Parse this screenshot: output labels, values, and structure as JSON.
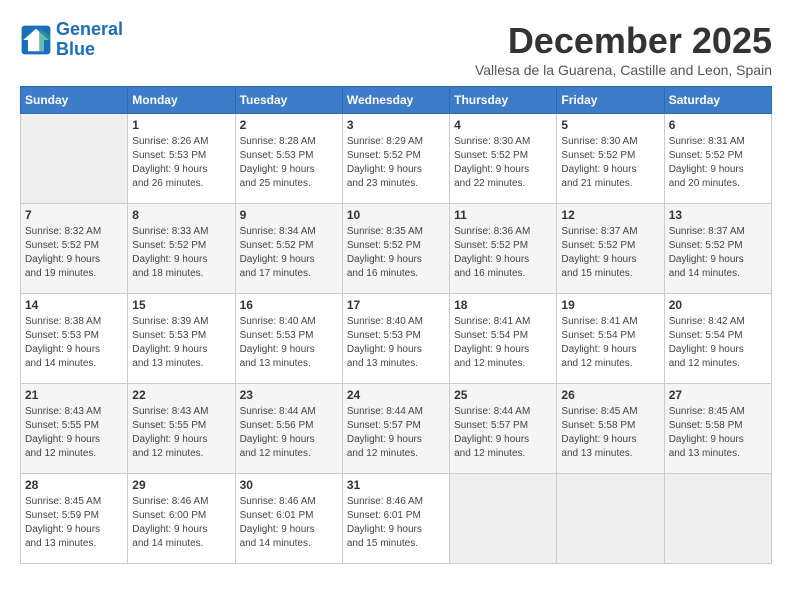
{
  "header": {
    "logo_line1": "General",
    "logo_line2": "Blue",
    "month_title": "December 2025",
    "location": "Vallesa de la Guarena, Castille and Leon, Spain"
  },
  "days_of_week": [
    "Sunday",
    "Monday",
    "Tuesday",
    "Wednesday",
    "Thursday",
    "Friday",
    "Saturday"
  ],
  "weeks": [
    [
      {
        "day": "",
        "info": ""
      },
      {
        "day": "1",
        "info": "Sunrise: 8:26 AM\nSunset: 5:53 PM\nDaylight: 9 hours\nand 26 minutes."
      },
      {
        "day": "2",
        "info": "Sunrise: 8:28 AM\nSunset: 5:53 PM\nDaylight: 9 hours\nand 25 minutes."
      },
      {
        "day": "3",
        "info": "Sunrise: 8:29 AM\nSunset: 5:52 PM\nDaylight: 9 hours\nand 23 minutes."
      },
      {
        "day": "4",
        "info": "Sunrise: 8:30 AM\nSunset: 5:52 PM\nDaylight: 9 hours\nand 22 minutes."
      },
      {
        "day": "5",
        "info": "Sunrise: 8:30 AM\nSunset: 5:52 PM\nDaylight: 9 hours\nand 21 minutes."
      },
      {
        "day": "6",
        "info": "Sunrise: 8:31 AM\nSunset: 5:52 PM\nDaylight: 9 hours\nand 20 minutes."
      }
    ],
    [
      {
        "day": "7",
        "info": "Sunrise: 8:32 AM\nSunset: 5:52 PM\nDaylight: 9 hours\nand 19 minutes."
      },
      {
        "day": "8",
        "info": "Sunrise: 8:33 AM\nSunset: 5:52 PM\nDaylight: 9 hours\nand 18 minutes."
      },
      {
        "day": "9",
        "info": "Sunrise: 8:34 AM\nSunset: 5:52 PM\nDaylight: 9 hours\nand 17 minutes."
      },
      {
        "day": "10",
        "info": "Sunrise: 8:35 AM\nSunset: 5:52 PM\nDaylight: 9 hours\nand 16 minutes."
      },
      {
        "day": "11",
        "info": "Sunrise: 8:36 AM\nSunset: 5:52 PM\nDaylight: 9 hours\nand 16 minutes."
      },
      {
        "day": "12",
        "info": "Sunrise: 8:37 AM\nSunset: 5:52 PM\nDaylight: 9 hours\nand 15 minutes."
      },
      {
        "day": "13",
        "info": "Sunrise: 8:37 AM\nSunset: 5:52 PM\nDaylight: 9 hours\nand 14 minutes."
      }
    ],
    [
      {
        "day": "14",
        "info": "Sunrise: 8:38 AM\nSunset: 5:53 PM\nDaylight: 9 hours\nand 14 minutes."
      },
      {
        "day": "15",
        "info": "Sunrise: 8:39 AM\nSunset: 5:53 PM\nDaylight: 9 hours\nand 13 minutes."
      },
      {
        "day": "16",
        "info": "Sunrise: 8:40 AM\nSunset: 5:53 PM\nDaylight: 9 hours\nand 13 minutes."
      },
      {
        "day": "17",
        "info": "Sunrise: 8:40 AM\nSunset: 5:53 PM\nDaylight: 9 hours\nand 13 minutes."
      },
      {
        "day": "18",
        "info": "Sunrise: 8:41 AM\nSunset: 5:54 PM\nDaylight: 9 hours\nand 12 minutes."
      },
      {
        "day": "19",
        "info": "Sunrise: 8:41 AM\nSunset: 5:54 PM\nDaylight: 9 hours\nand 12 minutes."
      },
      {
        "day": "20",
        "info": "Sunrise: 8:42 AM\nSunset: 5:54 PM\nDaylight: 9 hours\nand 12 minutes."
      }
    ],
    [
      {
        "day": "21",
        "info": "Sunrise: 8:43 AM\nSunset: 5:55 PM\nDaylight: 9 hours\nand 12 minutes."
      },
      {
        "day": "22",
        "info": "Sunrise: 8:43 AM\nSunset: 5:55 PM\nDaylight: 9 hours\nand 12 minutes."
      },
      {
        "day": "23",
        "info": "Sunrise: 8:44 AM\nSunset: 5:56 PM\nDaylight: 9 hours\nand 12 minutes."
      },
      {
        "day": "24",
        "info": "Sunrise: 8:44 AM\nSunset: 5:57 PM\nDaylight: 9 hours\nand 12 minutes."
      },
      {
        "day": "25",
        "info": "Sunrise: 8:44 AM\nSunset: 5:57 PM\nDaylight: 9 hours\nand 12 minutes."
      },
      {
        "day": "26",
        "info": "Sunrise: 8:45 AM\nSunset: 5:58 PM\nDaylight: 9 hours\nand 13 minutes."
      },
      {
        "day": "27",
        "info": "Sunrise: 8:45 AM\nSunset: 5:58 PM\nDaylight: 9 hours\nand 13 minutes."
      }
    ],
    [
      {
        "day": "28",
        "info": "Sunrise: 8:45 AM\nSunset: 5:59 PM\nDaylight: 9 hours\nand 13 minutes."
      },
      {
        "day": "29",
        "info": "Sunrise: 8:46 AM\nSunset: 6:00 PM\nDaylight: 9 hours\nand 14 minutes."
      },
      {
        "day": "30",
        "info": "Sunrise: 8:46 AM\nSunset: 6:01 PM\nDaylight: 9 hours\nand 14 minutes."
      },
      {
        "day": "31",
        "info": "Sunrise: 8:46 AM\nSunset: 6:01 PM\nDaylight: 9 hours\nand 15 minutes."
      },
      {
        "day": "",
        "info": ""
      },
      {
        "day": "",
        "info": ""
      },
      {
        "day": "",
        "info": ""
      }
    ]
  ]
}
